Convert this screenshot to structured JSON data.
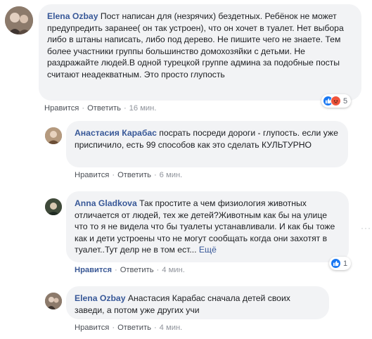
{
  "comments": [
    {
      "author": "Elena Ozbay",
      "text": "Пост написан для (незрячих) бездетных. Ребёнок не может предупредить заранее( он так устроен), что он хочет в туалет. Нет выбора либо в штаны написать, либо под дерево. Не пишите чего не знаете. Тем более участники группы большинство домохозяйки с детьми. Не раздражайте людей.В одной турецкой группе админа за подобные посты считают неадекватным. Это просто глупость",
      "like_label": "Нравится",
      "reply_label": "Ответить",
      "time": "16 мин.",
      "reaction_count": "5",
      "reaction_icons": [
        "like-icon",
        "angry-icon"
      ]
    },
    {
      "author": "Анастасия Карабас",
      "text": "посрать посреди дороги - глупость. если уже приспичило, есть 99 способов как это сделать КУЛЬТУРНО",
      "like_label": "Нравится",
      "reply_label": "Ответить",
      "time": "6 мин."
    },
    {
      "author": "Anna Gladkova",
      "text": "Так простите а чем физиология животных отличается от людей, тех же детей?Животным как бы на улице что то я не видела что бы туалеты устанавливали. И как бы тоже как и дети устроены что не могут сообщать когда они захотят в туалет..Тут делр не в том ест...",
      "more_label": "Ещё",
      "like_label": "Нравится",
      "reply_label": "Ответить",
      "time": "4 мин.",
      "reaction_count": "1",
      "reaction_icons": [
        "like-icon"
      ]
    },
    {
      "author": "Elena Ozbay",
      "text": "Анастасия Карабас сначала детей своих заведи, а потом уже других учи",
      "like_label": "Нравится",
      "reply_label": "Ответить",
      "time": "4 мин."
    }
  ],
  "colors": {
    "author": "#385898",
    "bubble": "#f2f3f5",
    "like_active": "#3a5895",
    "like_reaction": "#1877f2",
    "angry_reaction": "#f0543c"
  }
}
